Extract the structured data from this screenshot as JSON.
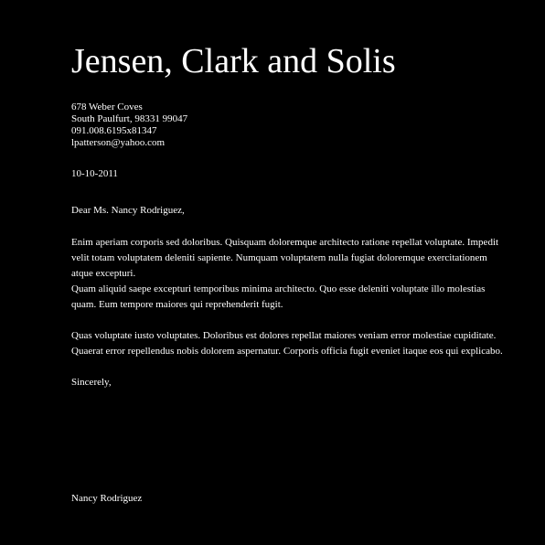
{
  "letterhead": {
    "company_name": "Jensen, Clark and Solis",
    "address_line1": "678 Weber Coves",
    "address_line2": "South Paulfurt, 98331 99047",
    "phone": "091.008.6195x81347",
    "email": "lpatterson@yahoo.com"
  },
  "letter": {
    "date": "10-10-2011",
    "salutation": "Dear Ms. Nancy Rodriguez,",
    "paragraphs": [
      "Enim aperiam corporis sed doloribus. Quisquam doloremque architecto ratione repellat voluptate. Impedit velit totam voluptatem deleniti sapiente. Numquam voluptatem nulla fugiat doloremque exercitationem atque excepturi.",
      "Quam aliquid saepe excepturi temporibus minima architecto. Quo esse deleniti voluptate illo molestias quam. Eum tempore maiores qui reprehenderit fugit.",
      "Quas voluptate iusto voluptates. Doloribus est dolores repellat maiores veniam error molestiae cupiditate. Quaerat error repellendus nobis dolorem aspernatur. Corporis officia fugit eveniet itaque eos qui explicabo."
    ],
    "closing": "Sincerely,",
    "signature_name": "Nancy Rodriguez"
  },
  "colors": {
    "background": "#000000",
    "text": "#ffffff"
  }
}
